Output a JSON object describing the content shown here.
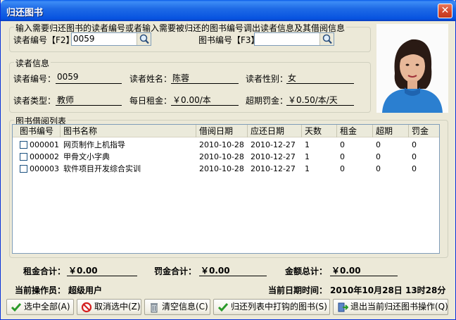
{
  "window": {
    "title": "归还图书",
    "close_glyph": "✕"
  },
  "search": {
    "group_title": "输入需要归还图书的读者编号或者输入需要被归还的图书编号调出读者信息及其借阅信息",
    "reader_label": "读者编号【F2】",
    "reader_value": "0059",
    "book_label": "图书编号【F3】",
    "book_value": ""
  },
  "reader": {
    "group_title": "读者信息",
    "id_label": "读者编号：",
    "id_value": "0059",
    "name_label": "读者姓名：",
    "name_value": "陈蓉",
    "gender_label": "读者性别：",
    "gender_value": "女",
    "type_label": "读者类型：",
    "type_value": "教师",
    "rent_label": "每日租金：",
    "rent_value": "￥0.00/本",
    "fine_label": "超期罚金：",
    "fine_value": "￥0.50/本/天"
  },
  "borrow_list": {
    "group_title": "图书借阅列表",
    "columns": [
      "图书编号",
      "图书名称",
      "借阅日期",
      "应还日期",
      "天数",
      "租金",
      "超期",
      "罚金"
    ],
    "rows": [
      {
        "id": "000001",
        "name": "网页制作上机指导",
        "borrow": "2010-10-28",
        "due": "2010-12-27",
        "days": "1",
        "rent": "0",
        "over": "0",
        "fine": "0"
      },
      {
        "id": "000002",
        "name": "甲骨文小字典",
        "borrow": "2010-10-28",
        "due": "2010-12-27",
        "days": "1",
        "rent": "0",
        "over": "0",
        "fine": "0"
      },
      {
        "id": "000003",
        "name": "软件项目开发综合实训",
        "borrow": "2010-10-28",
        "due": "2010-12-27",
        "days": "1",
        "rent": "0",
        "over": "0",
        "fine": "0"
      }
    ]
  },
  "summary": {
    "rent_total_label": "租金合计：",
    "rent_total_value": "￥0.00",
    "fine_total_label": "罚金合计：",
    "fine_total_value": "￥0.00",
    "amount_total_label": "金额总计：",
    "amount_total_value": "￥0.00",
    "operator_label": "当前操作员：",
    "operator_value": "超级用户",
    "datetime_label": "当前日期时间：",
    "datetime_value": "2010年10月28日  13时28分"
  },
  "toolbar": {
    "select_all": "选中全部(A)",
    "deselect": "取消选中(Z)",
    "clear": "清空信息(C)",
    "return_checked": "归还列表中打钩的图书(S)",
    "exit": "退出当前归还图书操作(Q)"
  },
  "colors": {
    "title_bar": "#0753e0",
    "window_bg": "#ece9d8",
    "close": "#d2452a"
  }
}
